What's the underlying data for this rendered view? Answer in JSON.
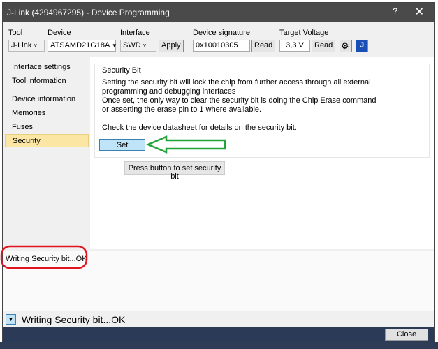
{
  "window": {
    "title": "J-Link (4294967295) - Device Programming",
    "help": "?",
    "close": "✕"
  },
  "toolbar": {
    "tool_label": "Tool",
    "tool_value": "J-Link",
    "device_label": "Device",
    "device_value": "ATSAMD21G18A",
    "interface_label": "Interface",
    "interface_value": "SWD",
    "apply": "Apply",
    "signature_label": "Device signature",
    "signature_value": "0x10010305",
    "read": "Read",
    "voltage_label": "Target Voltage",
    "voltage_value": "3,3 V",
    "read2": "Read",
    "jlink_icon_text": "J"
  },
  "sidebar": {
    "items": [
      {
        "label": "Interface settings"
      },
      {
        "label": "Tool information"
      },
      {
        "label": "Device information"
      },
      {
        "label": "Memories"
      },
      {
        "label": "Fuses"
      },
      {
        "label": "Security"
      }
    ]
  },
  "security": {
    "group_title": "Security Bit",
    "lines": [
      "Setting the security bit will lock the chip from further access through all external",
      "programming and debugging interfaces",
      "Once set, the only way to clear the security bit is doing the Chip Erase command",
      "or asserting the erase pin to 1 where available.",
      "",
      "Check the device datasheet for details on the security bit."
    ],
    "set_button": "Set",
    "hint": "Press button to set security bit"
  },
  "log": {
    "text": "Writing Security bit...OK"
  },
  "status": {
    "text": "Writing Security bit...OK"
  },
  "footer": {
    "close": "Close"
  },
  "colors": {
    "annotation_arrow": "#22a33a",
    "annotation_circle": "#e0151f",
    "selected": "#fce6a4"
  }
}
